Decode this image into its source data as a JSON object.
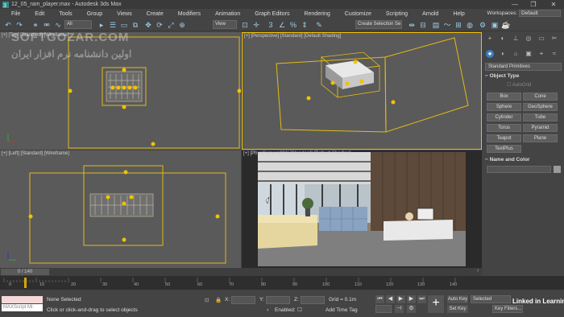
{
  "app": {
    "title": "12_05_ram_player.max - Autodesk 3ds Max"
  },
  "window_controls": [
    "—",
    "❐",
    "✕"
  ],
  "menu": [
    "File",
    "Edit",
    "Tools",
    "Group",
    "Views",
    "Create",
    "Modifiers",
    "Animation",
    "Graph Editors",
    "Rendering",
    "Customize",
    "Scripting",
    "Arnold",
    "Help"
  ],
  "workspaces": {
    "label": "Workspaces:",
    "value": "Default"
  },
  "toolbar": {
    "filter": "All",
    "refcoord": "View",
    "selection_set": "Create Selection Se"
  },
  "viewports": {
    "top": "[+] [Top] [Standard] [Wireframe]",
    "perspective": "[+] [Perspective] [Standard] [Default Shading]",
    "left": "[+] [Left] [Standard] [Wireframe]",
    "camera": "[+] [PhysCamera001] [Standard] [Default Shading]"
  },
  "watermark": {
    "site": "SOFTGOZAR.COM",
    "persian": "اولین دانشنامه نرم افزار ایران"
  },
  "command_panel": {
    "category": "Standard Primitives",
    "object_type": "Object Type",
    "autogrid": "AutoGrid",
    "buttons": [
      "Box",
      "Cone",
      "Sphere",
      "GeoSphere",
      "Cylinder",
      "Tube",
      "Torus",
      "Pyramid",
      "Teapot",
      "Plane",
      "TextPlus"
    ],
    "name_and_color": "Name and Color"
  },
  "time_slider": {
    "value": "0 / 140"
  },
  "trackbar": {
    "ticks": [
      "0",
      "10",
      "20",
      "30",
      "40",
      "50",
      "60",
      "70",
      "80",
      "90",
      "100",
      "110",
      "120",
      "130",
      "140"
    ]
  },
  "status": {
    "maxscript": "MAXScript Mi:",
    "selection": "None Selected",
    "prompt": "Click or click-and-drag to select objects",
    "x_label": "X:",
    "y_label": "Y:",
    "z_label": "Z:",
    "grid": "Grid = 0.1m",
    "enabled": "Enabled:",
    "add_time_tag": "Add Time Tag",
    "auto_key": "Auto Key",
    "selected": "Selected",
    "set_key": "Set Key",
    "key_filters": "Key Filters...",
    "linkedin": "Linked in Learning"
  }
}
